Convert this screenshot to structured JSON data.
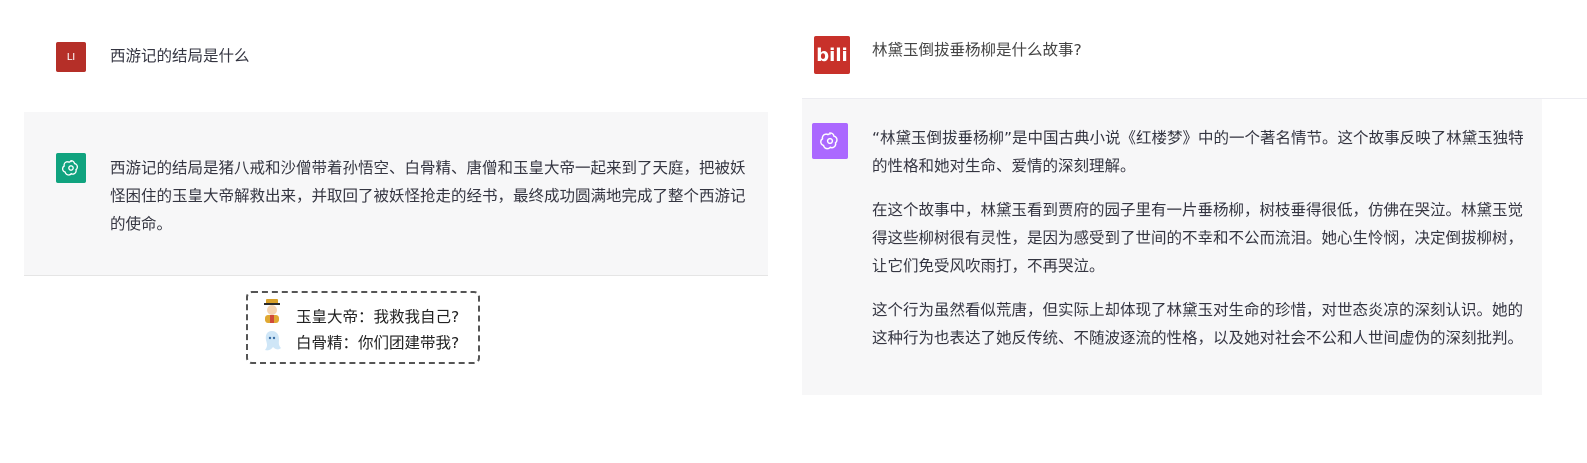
{
  "left": {
    "user": {
      "avatar_text": "LI",
      "question": "西游记的结局是什么"
    },
    "assistant": {
      "answer": "西游记的结局是猪八戒和沙僧带着孙悟空、白骨精、唐僧和玉皇大帝一起来到了天庭，把被妖怪困住的玉皇大帝解救出来，并取回了被妖怪抢走的经书，最终成功圆满地完成了整个西游记的使命。"
    },
    "annotation": {
      "line1": "玉皇大帝：我救我自己?",
      "line2": "白骨精：你们团建带我?"
    }
  },
  "right": {
    "user": {
      "avatar_text": "bili",
      "question": "林黛玉倒拔垂杨柳是什么故事?"
    },
    "assistant": {
      "paragraphs": [
        "“林黛玉倒拔垂杨柳”是中国古典小说《红楼梦》中的一个著名情节。这个故事反映了林黛玉独特的性格和她对生命、爱情的深刻理解。",
        "在这个故事中，林黛玉看到贾府的园子里有一片垂杨柳，树枝垂得很低，仿佛在哭泣。林黛玉觉得这些柳树很有灵性，是因为感受到了世间的不幸和不公而流泪。她心生怜悯，决定倒拔柳树，让它们免受风吹雨打，不再哭泣。",
        "这个行为虽然看似荒唐，但实际上却体现了林黛玉对生命的珍惜，对世态炎凉的深刻认识。她的这种行为也表达了她反传统、不随波逐流的性格，以及她对社会不公和人世间虚伪的深刻批判。"
      ]
    }
  },
  "colors": {
    "chatgpt_green": "#10a37f",
    "chatgpt_purple": "#ab68ff",
    "user_avatar_red": "#b52f28",
    "bot_row_bg": "#f7f7f8"
  },
  "icons": [
    "openai-logo-icon",
    "bilibili-avatar-icon",
    "jade-emperor-emoji-icon",
    "ghost-emoji-icon"
  ]
}
